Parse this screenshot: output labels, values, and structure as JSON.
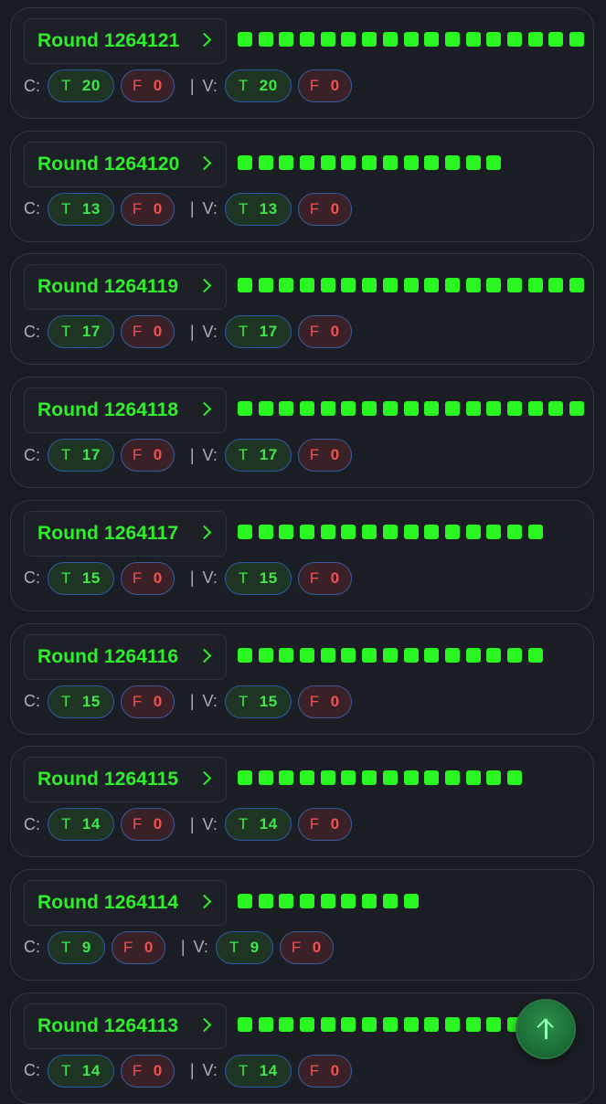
{
  "labels": {
    "c": "C:",
    "v": "V:",
    "sep": "|",
    "t": "T",
    "f": "F"
  },
  "rounds": [
    {
      "title": "Round 1264121",
      "squares": 17,
      "c_t": "20",
      "c_f": "0",
      "v_t": "20",
      "v_f": "0"
    },
    {
      "title": "Round 1264120",
      "squares": 13,
      "c_t": "13",
      "c_f": "0",
      "v_t": "13",
      "v_f": "0"
    },
    {
      "title": "Round 1264119",
      "squares": 17,
      "c_t": "17",
      "c_f": "0",
      "v_t": "17",
      "v_f": "0"
    },
    {
      "title": "Round 1264118",
      "squares": 17,
      "c_t": "17",
      "c_f": "0",
      "v_t": "17",
      "v_f": "0"
    },
    {
      "title": "Round 1264117",
      "squares": 15,
      "c_t": "15",
      "c_f": "0",
      "v_t": "15",
      "v_f": "0"
    },
    {
      "title": "Round 1264116",
      "squares": 15,
      "c_t": "15",
      "c_f": "0",
      "v_t": "15",
      "v_f": "0"
    },
    {
      "title": "Round 1264115",
      "squares": 14,
      "c_t": "14",
      "c_f": "0",
      "v_t": "14",
      "v_f": "0"
    },
    {
      "title": "Round 1264114",
      "squares": 9,
      "c_t": "9",
      "c_f": "0",
      "v_t": "9",
      "v_f": "0"
    },
    {
      "title": "Round 1264113",
      "squares": 14,
      "c_t": "14",
      "c_f": "0",
      "v_t": "14",
      "v_f": "0"
    }
  ],
  "colors": {
    "accent_green": "#2ef02a",
    "true_green": "#3ee84a",
    "false_red": "#f05252"
  },
  "icons": {
    "scroll_top": "arrow-up-icon",
    "expand": "chevron-right-icon"
  }
}
